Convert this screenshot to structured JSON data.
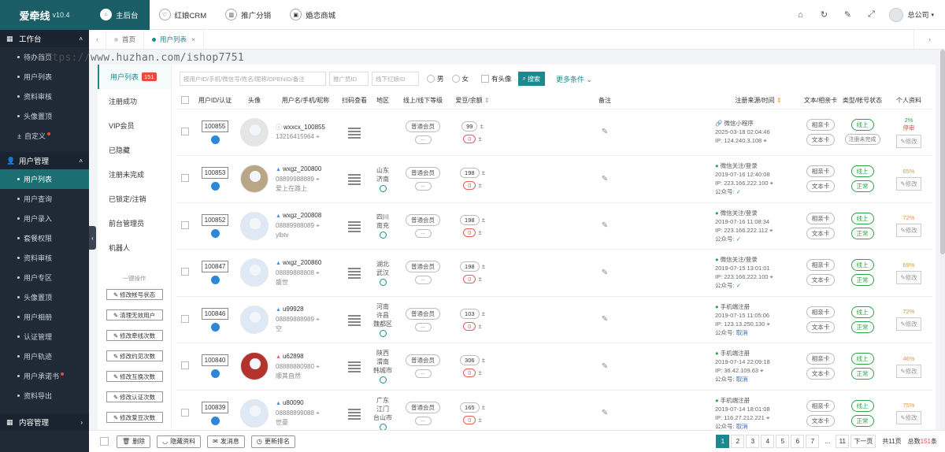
{
  "brand": {
    "name": "爱牵线",
    "version": "v10.4"
  },
  "sidebar": {
    "sections": [
      {
        "title": "工作台",
        "items": [
          {
            "label": "待办首页",
            "dot": false
          },
          {
            "label": "用户列表",
            "dot": false
          },
          {
            "label": "资料审核",
            "dot": false
          },
          {
            "label": "头像置顶",
            "dot": false
          },
          {
            "label": "自定义",
            "dot": true,
            "plus": true
          }
        ]
      },
      {
        "title": "用户管理",
        "items": [
          {
            "label": "用户列表",
            "dot": false,
            "active": true
          },
          {
            "label": "用户查询",
            "dot": false
          },
          {
            "label": "用户录入",
            "dot": false
          },
          {
            "label": "套餐权限",
            "dot": false
          },
          {
            "label": "资料审核",
            "dot": false
          },
          {
            "label": "用户专区",
            "dot": false
          },
          {
            "label": "头像置顶",
            "dot": false
          },
          {
            "label": "用户相册",
            "dot": false
          },
          {
            "label": "认证管理",
            "dot": false
          },
          {
            "label": "用户轨迹",
            "dot": false
          },
          {
            "label": "用户承诺书",
            "dot": true
          },
          {
            "label": "资料导出",
            "dot": false
          }
        ]
      },
      {
        "title": "内容管理",
        "items": []
      }
    ]
  },
  "topnav": {
    "items": [
      "主后台",
      "红娘CRM",
      "推广分销",
      "婚恋商城"
    ],
    "user": "总公司"
  },
  "tabs": {
    "items": [
      "首页",
      "用户列表"
    ]
  },
  "watermark": "https://www.huzhan.com/ishop7751",
  "subnav": {
    "items": [
      "用户列表",
      "注册成功",
      "VIP会员",
      "已隐藏",
      "注册未完成",
      "已锁定/注销",
      "前台管理员",
      "机器人"
    ],
    "count": "151",
    "quick_title": "一键操作",
    "quick_buttons": [
      "修改帐号状态",
      "清理无效用户",
      "修改牵线次数",
      "修改约见次数",
      "修改互换次数",
      "修改认证次数",
      "修改爱豆次数"
    ]
  },
  "filter": {
    "placeholder_main": "按用户ID/手机/微信号/姓名/昵称/OPENID/备注",
    "placeholder_staff": "推广员ID",
    "placeholder_matchmaker": "线下红娘ID",
    "male": "男",
    "female": "女",
    "has_avatar": "有头像",
    "search": "搜索",
    "more": "更多条件"
  },
  "table": {
    "headers": [
      "用户ID/认证",
      "头像",
      "用户名/手机/昵称",
      "扫码查看",
      "地区",
      "线上/线下等级",
      "爱豆/余额",
      "备注",
      "注册来源/时间",
      "文本/相亲卡",
      "类型/帐号状态",
      "个人资料"
    ],
    "rows": [
      {
        "id": "100855",
        "avatar": "grey",
        "sex": "none",
        "name": "wxxcx_100855",
        "phone": "13216415964",
        "nick": "",
        "region": [],
        "level1": "普通会员",
        "level2": "--",
        "beans": "99",
        "balance": "0",
        "src_type": "mini",
        "src": "微信小程序",
        "time": "2025-03-18 02:04:46",
        "ip": "IP: 124.240.3.108",
        "gzh": "",
        "gzh_state": "",
        "card1": "相亲卡",
        "card2": "文本卡",
        "type": "线上",
        "status": "注册未完成",
        "status_on": false,
        "pct": "2%",
        "stop": "停审",
        "modify": "修改"
      },
      {
        "id": "100853",
        "avatar": "photo1",
        "sex": "m",
        "name": "wxgz_200800",
        "phone": "08899988889",
        "nick": "爱上在路上",
        "region": [
          "山东",
          "济南"
        ],
        "level1": "普通会员",
        "level2": "--",
        "beans": "198",
        "balance": "0",
        "src_type": "wx",
        "src": "微信关注/登录",
        "time": "2019-07-16 12:40:08",
        "ip": "IP: 223.166.222.100",
        "gzh": "公众号:",
        "gzh_state": "ok",
        "card1": "相亲卡",
        "card2": "文本卡",
        "type": "线上",
        "status": "正常",
        "status_on": true,
        "pct": "65%",
        "stop": "",
        "modify": "修改"
      },
      {
        "id": "100852",
        "avatar": "blue",
        "sex": "m",
        "name": "wxgz_200808",
        "phone": "08889988089",
        "nick": "ylbtv",
        "region": [
          "四川",
          "南充"
        ],
        "level1": "普通会员",
        "level2": "--",
        "beans": "198",
        "balance": "0",
        "src_type": "wx",
        "src": "微信关注/登录",
        "time": "2019-07-16 11:08:34",
        "ip": "IP: 223.166.222.112",
        "gzh": "公众号:",
        "gzh_state": "ok",
        "card1": "相亲卡",
        "card2": "文本卡",
        "type": "线上",
        "status": "正常",
        "status_on": true,
        "pct": "72%",
        "stop": "",
        "modify": "修改"
      },
      {
        "id": "100847",
        "avatar": "blue",
        "sex": "m",
        "name": "wxgz_200860",
        "phone": "08889888808",
        "nick": "盛世",
        "region": [
          "湖北",
          "武汉"
        ],
        "level1": "普通会员",
        "level2": "--",
        "beans": "198",
        "balance": "0",
        "src_type": "wx",
        "src": "微信关注/登录",
        "time": "2019-07-15 13:01:01",
        "ip": "IP: 223.166.222.100",
        "gzh": "公众号:",
        "gzh_state": "ok",
        "card1": "相亲卡",
        "card2": "文本卡",
        "type": "线上",
        "status": "正常",
        "status_on": true,
        "pct": "69%",
        "stop": "",
        "modify": "修改"
      },
      {
        "id": "100846",
        "avatar": "blue",
        "sex": "m",
        "name": "u99928",
        "phone": "08889888989",
        "nick": "空",
        "region": [
          "河南",
          "许昌",
          "魏都区"
        ],
        "level1": "普通会员",
        "level2": "--",
        "beans": "103",
        "balance": "0",
        "src_type": "wx",
        "src": "手机端注册",
        "time": "2019-07-15 11:05:06",
        "ip": "IP: 123.13.250.130",
        "gzh": "公众号:",
        "gzh_state": "取消",
        "card1": "相亲卡",
        "card2": "文本卡",
        "type": "线上",
        "status": "正常",
        "status_on": true,
        "pct": "72%",
        "stop": "",
        "modify": "修改"
      },
      {
        "id": "100840",
        "avatar": "photo2",
        "sex": "f",
        "name": "u62898",
        "phone": "08888880980",
        "nick": "顺其自然",
        "region": [
          "陕西",
          "渭南",
          "韩城市"
        ],
        "level1": "普通会员",
        "level2": "--",
        "beans": "306",
        "balance": "0",
        "src_type": "wx",
        "src": "手机端注册",
        "time": "2019-07-14 22:09:18",
        "ip": "IP: 36.42.109.63",
        "gzh": "公众号:",
        "gzh_state": "取消",
        "card1": "相亲卡",
        "card2": "文本卡",
        "type": "线上",
        "status": "正常",
        "status_on": true,
        "pct": "46%",
        "stop": "",
        "modify": "修改"
      },
      {
        "id": "100839",
        "avatar": "blue",
        "sex": "m",
        "name": "u80090",
        "phone": "08888899088",
        "nick": "世豪",
        "region": [
          "广东",
          "江门",
          "台山市"
        ],
        "level1": "普通会员",
        "level2": "--",
        "beans": "165",
        "balance": "0",
        "src_type": "wx",
        "src": "手机端注册",
        "time": "2019-07-14 18:01:08",
        "ip": "IP: 116.27.212.221",
        "gzh": "公众号:",
        "gzh_state": "取消",
        "card1": "相亲卡",
        "card2": "文本卡",
        "type": "线上",
        "status": "正常",
        "status_on": true,
        "pct": "75%",
        "stop": "",
        "modify": "修改"
      }
    ]
  },
  "bottom": {
    "buttons": [
      "删除",
      "隐藏资料",
      "发消息",
      "更新排名"
    ],
    "pages": [
      "1",
      "2",
      "3",
      "4",
      "5",
      "6",
      "7",
      "...",
      "11",
      "下一页"
    ],
    "total_pages": "共11页",
    "total_prefix": "总数",
    "total": "151",
    "total_suffix": "条"
  },
  "colors": {
    "accent": "#1b8a8f",
    "brand": "#1b5d66",
    "sidebar": "#1f2a36",
    "danger": "#e84a3b",
    "ok": "#2da24a"
  }
}
